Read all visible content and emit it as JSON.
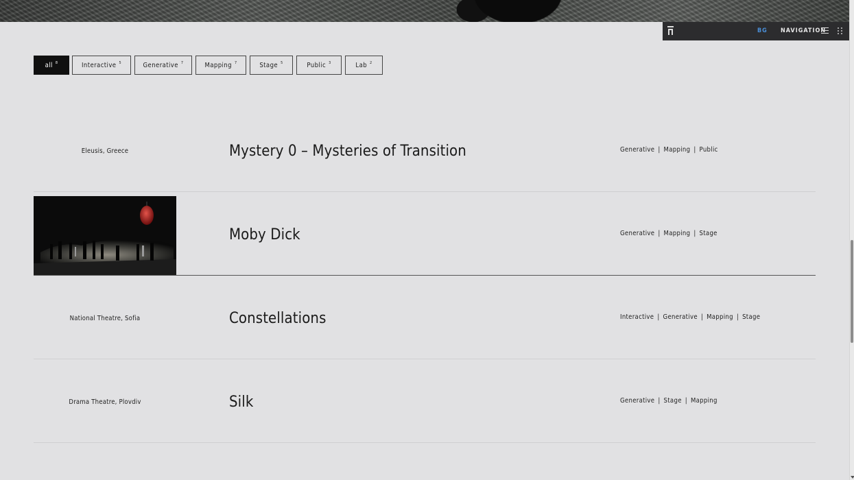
{
  "header": {
    "lang": "BG",
    "nav_label": "NAVIGATION",
    "icons": [
      "logo-icon",
      "hamburger-icon",
      "grid-dots-icon"
    ]
  },
  "filters": [
    {
      "label": "all",
      "count": "8",
      "active": true
    },
    {
      "label": "Interactive",
      "count": "5",
      "active": false
    },
    {
      "label": "Generative",
      "count": "7",
      "active": false
    },
    {
      "label": "Mapping",
      "count": "7",
      "active": false
    },
    {
      "label": "Stage",
      "count": "5",
      "active": false
    },
    {
      "label": "Public",
      "count": "3",
      "active": false
    },
    {
      "label": "Lab",
      "count": "2",
      "active": false
    }
  ],
  "projects": [
    {
      "location": "Eleusis, Greece",
      "title": "Mystery 0 – Mysteries of Transition",
      "tags": [
        "Generative",
        "Mapping",
        "Public"
      ]
    },
    {
      "location": "",
      "title": "Moby Dick",
      "tags": [
        "Generative",
        "Mapping",
        "Stage"
      ],
      "has_image": true
    },
    {
      "location": "National Theatre, Sofia",
      "title": "Constellations",
      "tags": [
        "Interactive",
        "Generative",
        "Mapping",
        "Stage"
      ]
    },
    {
      "location": "Drama Theatre, Plovdiv",
      "title": "Silk",
      "tags": [
        "Generative",
        "Stage",
        "Mapping"
      ]
    }
  ],
  "colors": {
    "background": "#e1e1e3",
    "navbar": "#2c2c2e",
    "lang_accent": "#4a8fd8",
    "active_filter": "#101010"
  }
}
